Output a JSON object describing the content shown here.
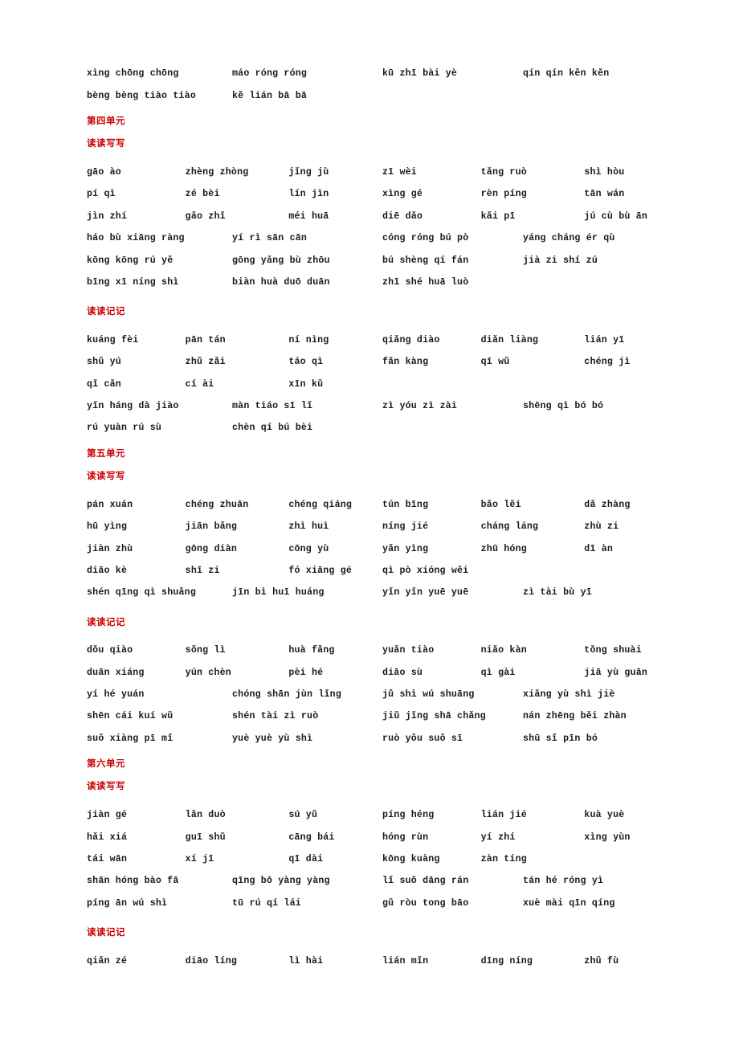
{
  "document": {
    "type": "pinyin-word-list",
    "heading_color": "#cc0000",
    "text_color": "#1a1a1a"
  },
  "intro_rows": [
    {
      "columns": 4,
      "cells": [
        "xìng chōng chōng",
        "máo róng róng",
        "kū zhī bài yè",
        "qín qín kěn kěn"
      ]
    },
    {
      "columns": 4,
      "cells": [
        "bèng bèng tiào tiào",
        "kě lián bā bā",
        "",
        ""
      ]
    }
  ],
  "sections": [
    {
      "unit": "第四单元",
      "groups": [
        {
          "label": "读读写写",
          "rows": [
            {
              "columns": 6,
              "cells": [
                "gāo ào",
                "zhèng zhòng",
                "jǐng jù",
                "zī wèi",
                "tǎng ruò",
                "shì hòu"
              ]
            },
            {
              "columns": 6,
              "cells": [
                "pí qì",
                "zé bèi",
                "lín jìn",
                "xìng gé",
                "rèn píng",
                "tān wán"
              ]
            },
            {
              "columns": 6,
              "cells": [
                "jìn zhí",
                "gǎo zhǐ",
                "méi huā",
                "diē dǎo",
                "kǎi pī",
                "jú cù bù ān"
              ]
            },
            {
              "columns": 4,
              "cells": [
                "háo bù xiāng ràng",
                "yí rì sān cān",
                "cóng róng bú pò",
                "yáng cháng ér qù"
              ]
            },
            {
              "columns": 4,
              "cells": [
                "kōng kōng rú yě",
                "gōng yǎng bù zhōu",
                "bú shèng qí fán",
                "jià zi shí zú"
              ]
            },
            {
              "columns": 4,
              "cells": [
                "bīng xī níng shì",
                "biàn huà duō duān",
                "zhī shé huā luò",
                ""
              ]
            }
          ]
        },
        {
          "label": "读读记记",
          "rows": [
            {
              "columns": 6,
              "cells": [
                "kuáng fèi",
                "pān tán",
                "ní nìng",
                "qiǎng diào",
                "diǎn liàng",
                "lián yī"
              ]
            },
            {
              "columns": 6,
              "cells": [
                "shǔ yú",
                "zhǔ zǎi",
                "táo qì",
                "fǎn kàng",
                "qī wǔ",
                "chéng jì"
              ]
            },
            {
              "columns": 6,
              "cells": [
                "qǐ cǎn",
                "cí ài",
                "xīn kǔ",
                "",
                "",
                ""
              ]
            },
            {
              "columns": 4,
              "cells": [
                "yǐn háng dà jiào",
                "màn tiáo sī lǐ",
                "zì yóu zì zài",
                "shēng qì bó bó"
              ]
            },
            {
              "columns": 4,
              "cells": [
                "rú yuàn rú sù",
                "chèn qí bú bèi",
                "",
                ""
              ]
            }
          ]
        }
      ]
    },
    {
      "unit": "第五单元",
      "groups": [
        {
          "label": "读读写写",
          "rows": [
            {
              "columns": 6,
              "cells": [
                "pán xuán",
                "chéng zhuān",
                "chéng qiáng",
                "tún bīng",
                "bǎo lěi",
                "dǎ zhàng"
              ]
            },
            {
              "columns": 6,
              "cells": [
                "hū yìng",
                "jiān bǎng",
                "zhì huì",
                "níng jié",
                "cháng láng",
                "zhù zi"
              ]
            },
            {
              "columns": 6,
              "cells": [
                "jiàn zhù",
                "gōng diàn",
                "cōng yù",
                "yǎn yìng",
                "zhū hóng",
                "dī àn"
              ]
            },
            {
              "columns": 6,
              "cells": [
                "diāo kè",
                "shī zi",
                "fó xiāng gé",
                "qì pò xióng wěi",
                "",
                ""
              ]
            },
            {
              "columns": 4,
              "cells": [
                "shén qīng qì shuǎng",
                "jīn bì huī huáng",
                "yǐn yǐn yuē yuē",
                "zì tài bù yī"
              ]
            }
          ]
        },
        {
          "label": "读读记记",
          "rows": [
            {
              "columns": 6,
              "cells": [
                "dǒu qiào",
                "sǒng lì",
                "huà fǎng",
                "yuǎn tiào",
                "niǎo kàn",
                "tǒng shuài"
              ]
            },
            {
              "columns": 6,
              "cells": [
                "duān xiáng",
                "yún chèn",
                "pèi hé",
                "diāo sù",
                "qì gài",
                "jiā yù guān"
              ]
            },
            {
              "columns": 4,
              "cells": [
                "yí hé yuán",
                "chóng shān jùn lǐng",
                "jǔ shì wú shuāng",
                "xiǎng yù shì jiè"
              ]
            },
            {
              "columns": 4,
              "cells": [
                "shēn cái kuí wǔ",
                "shén tài zì ruò",
                "jiǔ jǐng shā chǎng",
                "nán zhēng běi zhàn"
              ]
            },
            {
              "columns": 4,
              "cells": [
                "suǒ xiàng pī mǐ",
                "yuè yuè yù shì",
                "ruò yǒu suǒ sī",
                "shū sǐ pīn bó"
              ]
            }
          ]
        }
      ]
    },
    {
      "unit": "第六单元",
      "groups": [
        {
          "label": "读读写写",
          "rows": [
            {
              "columns": 6,
              "cells": [
                "jiàn gé",
                "lǎn duò",
                "sú yǔ",
                "píng héng",
                "lián jié",
                "kuà yuè"
              ]
            },
            {
              "columns": 6,
              "cells": [
                "hǎi xiá",
                "guī shǔ",
                "cāng bái",
                "hóng rùn",
                "yí zhí",
                "xìng yùn"
              ]
            },
            {
              "columns": 6,
              "cells": [
                "tái wān",
                "xí jī",
                "qī dài",
                "kōng kuàng",
                "zàn tíng",
                ""
              ]
            },
            {
              "columns": 4,
              "cells": [
                "shān hóng bào fā",
                "qīng bō yàng yàng",
                "lǐ suǒ dāng rán",
                "tán hé róng yì"
              ]
            },
            {
              "columns": 4,
              "cells": [
                "píng ān wú shì",
                "tū rú qí lái",
                "gǔ ròu tong bāo",
                "xuè mài qīn qíng"
              ]
            }
          ]
        },
        {
          "label": "读读记记",
          "rows": [
            {
              "columns": 6,
              "cells": [
                "qiǎn zé",
                "diāo líng",
                "lì hài",
                "lián mǐn",
                "dīng níng",
                "zhǔ fù"
              ]
            }
          ]
        }
      ]
    }
  ]
}
